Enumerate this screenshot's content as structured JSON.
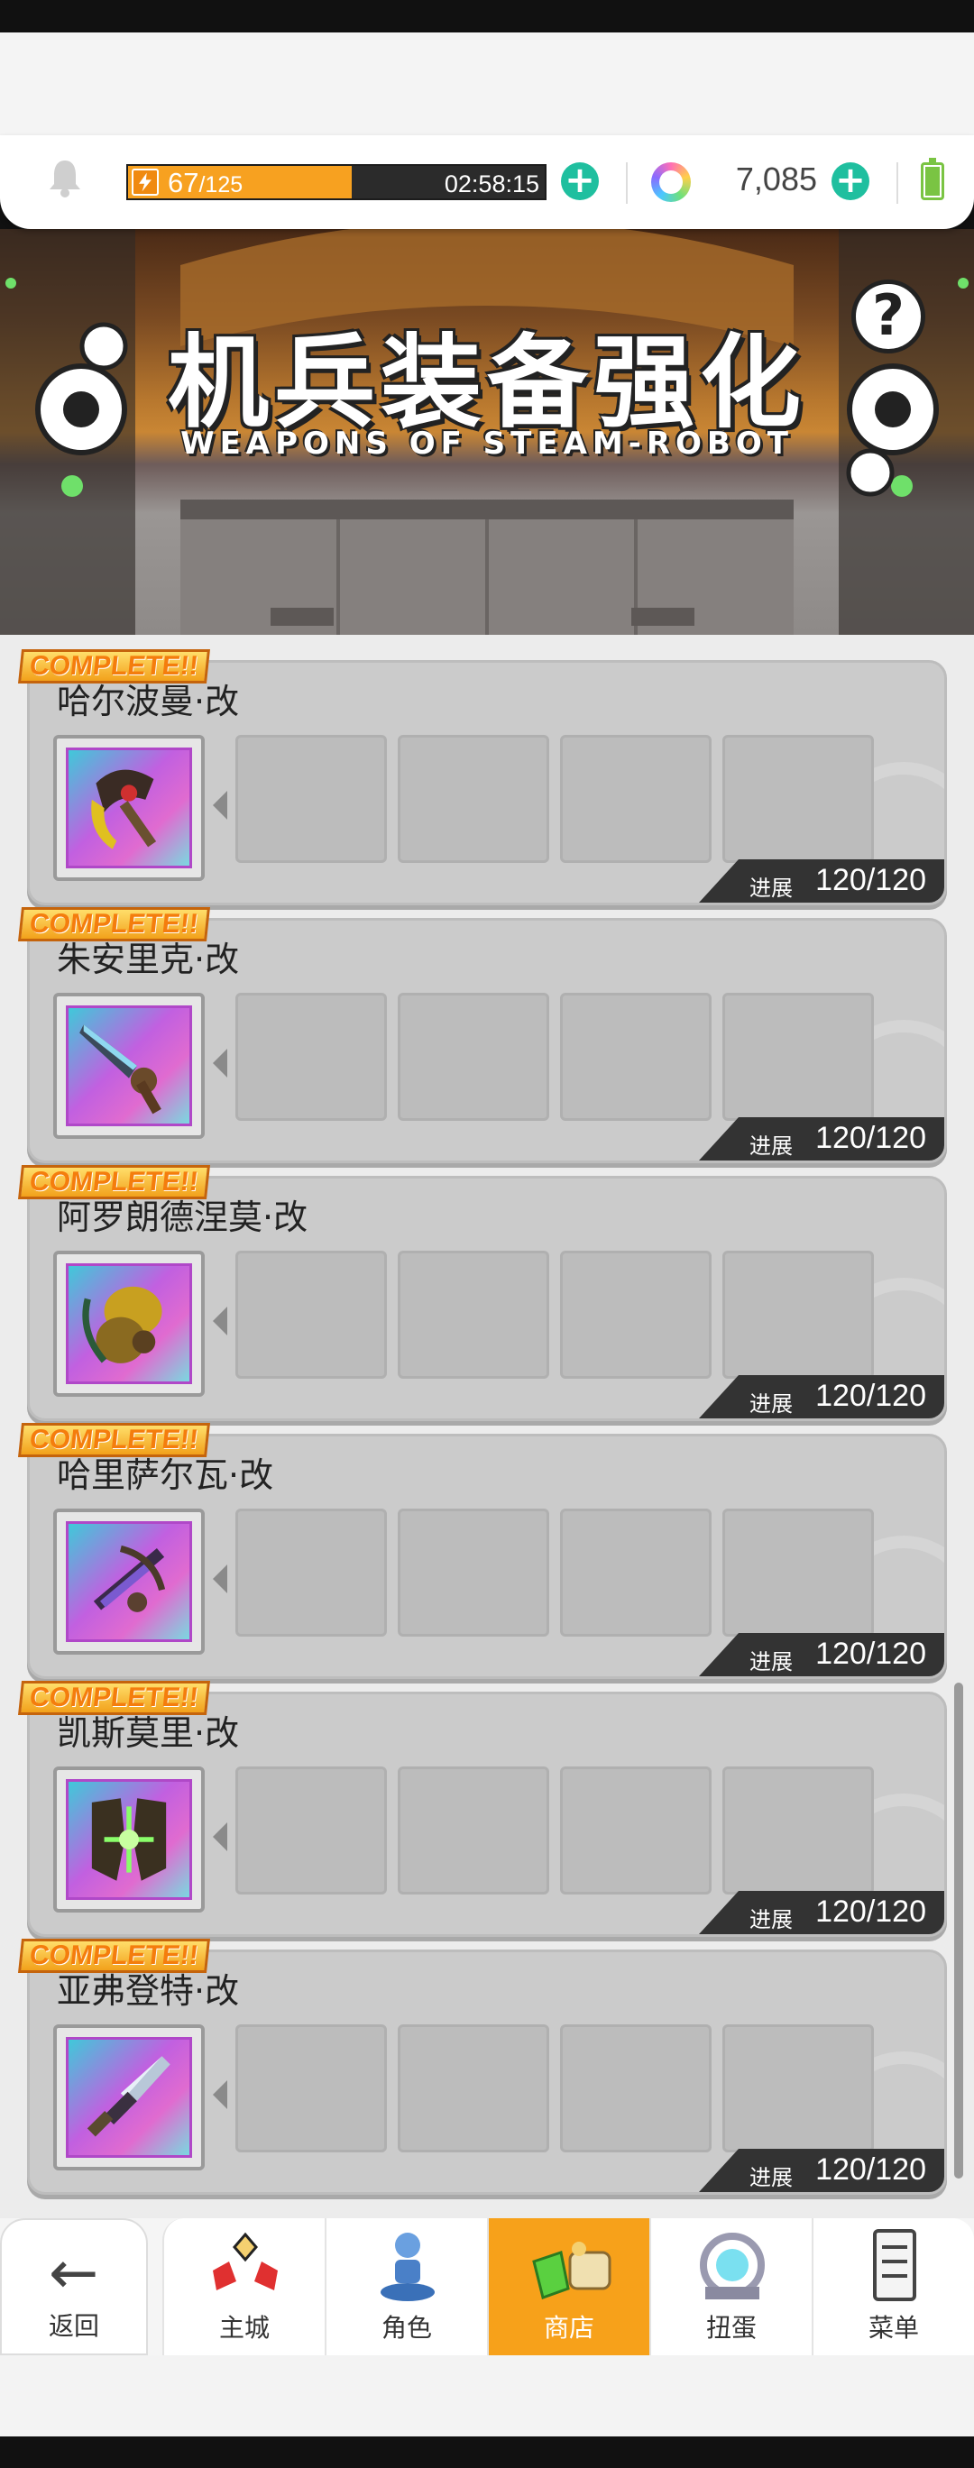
{
  "topbar": {
    "energy_current": "67",
    "energy_max": "/125",
    "energy_fraction": 0.536,
    "timer": "02:58:15",
    "gem_count": "7,085",
    "plus_symbol": "+"
  },
  "banner": {
    "title": "机兵装备强化",
    "subtitle": "WEAPONS OF STEAM-ROBOT",
    "help_symbol": "?"
  },
  "complete_text": "COMPLETE!!",
  "progress_label": "进展",
  "cards": [
    {
      "name": "哈尔波曼·改",
      "progress": "120/120",
      "icon": "axe-icon"
    },
    {
      "name": "朱安里克·改",
      "progress": "120/120",
      "icon": "blade-icon"
    },
    {
      "name": "阿罗朗德涅莫·改",
      "progress": "120/120",
      "icon": "gauntlet-icon"
    },
    {
      "name": "哈里萨尔瓦·改",
      "progress": "120/120",
      "icon": "crossbow-icon"
    },
    {
      "name": "凯斯莫里·改",
      "progress": "120/120",
      "icon": "armor-icon"
    },
    {
      "name": "亚弗登特·改",
      "progress": "120/120",
      "icon": "sword-icon"
    }
  ],
  "nav": {
    "back_label": "返回",
    "items": [
      {
        "label": "主城",
        "icon": "castle-icon"
      },
      {
        "label": "角色",
        "icon": "character-icon"
      },
      {
        "label": "商店",
        "icon": "shop-icon",
        "active": true
      },
      {
        "label": "扭蛋",
        "icon": "gacha-icon"
      },
      {
        "label": "菜单",
        "icon": "menu-icon"
      }
    ]
  },
  "colors": {
    "accent": "#f7a11a",
    "plus": "#1fbf9f",
    "card": "#cbcbcb",
    "progress_bg": "#333333"
  }
}
